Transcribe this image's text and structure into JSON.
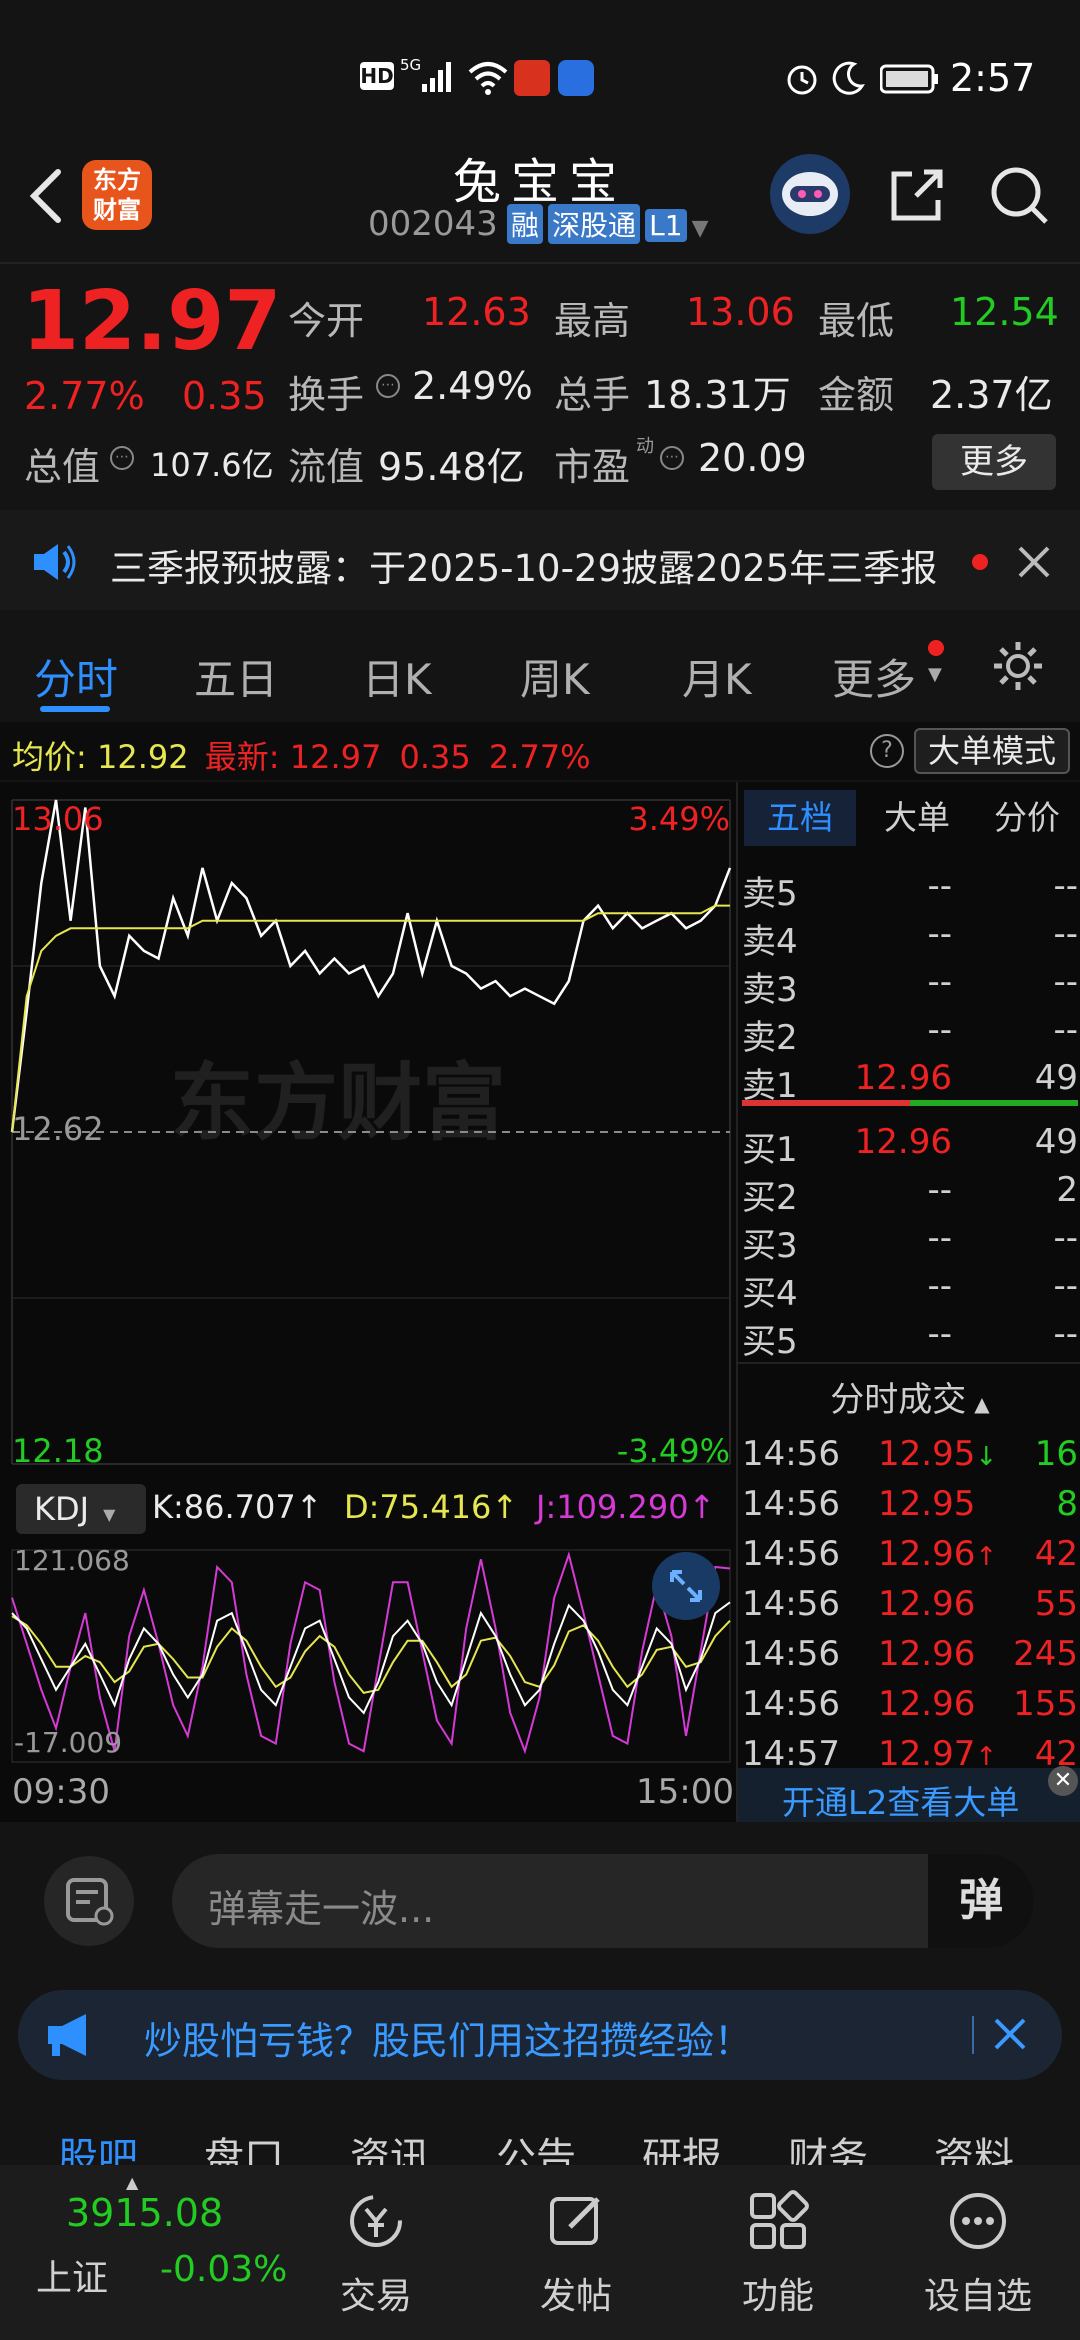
{
  "status_bar": {
    "time": "2:57",
    "left_icons": [
      "hd-icon",
      "5g-signal-icon",
      "wifi-icon",
      "red-app-icon",
      "blue-app-icon"
    ]
  },
  "header": {
    "logo_text_line1": "东方",
    "logo_text_line2": "财富",
    "stock_name": "兔宝宝",
    "stock_code": "002043",
    "badge_rong": "融",
    "badge_sgt": "深股通",
    "badge_level": "L1"
  },
  "quote": {
    "price": "12.97",
    "change_pct": "2.77%",
    "change": "0.35",
    "open_label": "今开",
    "open": "12.63",
    "high_label": "最高",
    "high": "13.06",
    "low_label": "最低",
    "low": "12.54",
    "turnover_label": "换手",
    "turnover": "2.49%",
    "volume_label": "总手",
    "volume": "18.31万",
    "amount_label": "金额",
    "amount": "2.37亿",
    "mktcap_label": "总值",
    "mktcap": "107.6亿",
    "float_label": "流值",
    "float": "95.48亿",
    "pe_label": "市盈",
    "pe_sup": "动",
    "pe": "20.09",
    "more_button": "更多"
  },
  "notice": {
    "text": "三季报预披露：于2025-10-29披露2025年三季报"
  },
  "tabs": [
    {
      "label": "分时"
    },
    {
      "label": "五日"
    },
    {
      "label": "日K"
    },
    {
      "label": "周K"
    },
    {
      "label": "月K"
    },
    {
      "label": "更多"
    }
  ],
  "infobar": {
    "avg_label": "均价:",
    "avg": "12.92",
    "latest_label": "最新:",
    "latest": "12.97",
    "chg": "0.35",
    "chg_pct": "2.77%",
    "mode_button": "大单模式"
  },
  "chart_data": {
    "type": "line",
    "title": "",
    "y_top": "13.06",
    "y_mid": "12.62",
    "y_bot": "12.18",
    "pct_top": "3.49%",
    "pct_bot": "-3.49%",
    "watermark": "东方财富",
    "x_start": "09:30",
    "x_end": "15:00",
    "ylim": [
      12.18,
      13.06
    ],
    "series": [
      {
        "name": "",
        "color": "#ffffff",
        "values": [
          12.62,
          12.78,
          12.95,
          13.06,
          12.9,
          13.05,
          12.84,
          12.8,
          12.88,
          12.86,
          12.85,
          12.93,
          12.88,
          12.97,
          12.9,
          12.95,
          12.93,
          12.88,
          12.9,
          12.84,
          12.86,
          12.83,
          12.85,
          12.83,
          12.84,
          12.8,
          12.83,
          12.91,
          12.83,
          12.9,
          12.84,
          12.83,
          12.81,
          12.82,
          12.8,
          12.81,
          12.8,
          12.79,
          12.82,
          12.9,
          12.92,
          12.89,
          12.91,
          12.89,
          12.9,
          12.91,
          12.89,
          12.9,
          12.92,
          12.97
        ]
      },
      {
        "name": "",
        "color": "#e6e650",
        "values": [
          12.62,
          12.8,
          12.86,
          12.88,
          12.89,
          12.89,
          12.89,
          12.89,
          12.89,
          12.89,
          12.89,
          12.89,
          12.89,
          12.9,
          12.9,
          12.9,
          12.9,
          12.9,
          12.9,
          12.9,
          12.9,
          12.9,
          12.9,
          12.9,
          12.9,
          12.9,
          12.9,
          12.9,
          12.9,
          12.9,
          12.9,
          12.9,
          12.9,
          12.9,
          12.9,
          12.9,
          12.9,
          12.9,
          12.9,
          12.9,
          12.91,
          12.91,
          12.91,
          12.91,
          12.91,
          12.91,
          12.91,
          12.91,
          12.92,
          12.92
        ]
      }
    ]
  },
  "kdj": {
    "selector": "KDJ",
    "k": "K:86.707",
    "d": "D:75.416",
    "j": "J:109.290",
    "y_top": "121.068",
    "y_bot": "-17.009",
    "ylim": [
      -17.009,
      121.068
    ],
    "k_values": [
      80,
      70,
      50,
      30,
      45,
      60,
      40,
      20,
      50,
      70,
      60,
      40,
      25,
      40,
      75,
      80,
      55,
      30,
      20,
      45,
      70,
      75,
      50,
      25,
      15,
      35,
      65,
      75,
      60,
      35,
      20,
      50,
      80,
      65,
      40,
      20,
      30,
      60,
      85,
      75,
      55,
      30,
      20,
      45,
      70,
      60,
      30,
      50,
      80,
      87
    ],
    "d_values": [
      78,
      72,
      60,
      45,
      45,
      52,
      48,
      35,
      42,
      58,
      60,
      50,
      38,
      38,
      58,
      70,
      62,
      45,
      32,
      38,
      55,
      65,
      58,
      40,
      28,
      30,
      48,
      62,
      62,
      48,
      32,
      40,
      62,
      64,
      52,
      35,
      32,
      46,
      68,
      72,
      62,
      45,
      32,
      40,
      56,
      58,
      45,
      48,
      65,
      75
    ],
    "j_values": [
      90,
      60,
      30,
      5,
      45,
      80,
      25,
      -10,
      65,
      95,
      60,
      20,
      0,
      45,
      110,
      100,
      40,
      0,
      -5,
      60,
      100,
      95,
      35,
      -5,
      -10,
      45,
      100,
      100,
      55,
      10,
      -5,
      70,
      115,
      70,
      15,
      -10,
      25,
      90,
      118,
      80,
      40,
      0,
      -5,
      55,
      98,
      65,
      0,
      55,
      110,
      109
    ]
  },
  "side_tabs": [
    {
      "label": "五档"
    },
    {
      "label": "大单"
    },
    {
      "label": "分价"
    }
  ],
  "order_book": {
    "asks": [
      {
        "label": "卖5",
        "price": "--",
        "vol": "--"
      },
      {
        "label": "卖4",
        "price": "--",
        "vol": "--"
      },
      {
        "label": "卖3",
        "price": "--",
        "vol": "--"
      },
      {
        "label": "卖2",
        "price": "--",
        "vol": "--"
      },
      {
        "label": "卖1",
        "price": "12.96",
        "vol": "49"
      }
    ],
    "bids": [
      {
        "label": "买1",
        "price": "12.96",
        "vol": "49"
      },
      {
        "label": "买2",
        "price": "--",
        "vol": "2"
      },
      {
        "label": "买3",
        "price": "--",
        "vol": "--"
      },
      {
        "label": "买4",
        "price": "--",
        "vol": "--"
      },
      {
        "label": "买5",
        "price": "--",
        "vol": "--"
      }
    ]
  },
  "trades": {
    "header": "分时成交",
    "rows": [
      {
        "time": "14:56",
        "price": "12.95",
        "arrow": "↓",
        "vol": "16",
        "vol_color": "#22cc22"
      },
      {
        "time": "14:56",
        "price": "12.95",
        "arrow": "",
        "vol": "8",
        "vol_color": "#22cc22"
      },
      {
        "time": "14:56",
        "price": "12.96",
        "arrow": "↑",
        "vol": "42",
        "vol_color": "#ee2222"
      },
      {
        "time": "14:56",
        "price": "12.96",
        "arrow": "",
        "vol": "55",
        "vol_color": "#ee2222"
      },
      {
        "time": "14:56",
        "price": "12.96",
        "arrow": "",
        "vol": "245",
        "vol_color": "#ee2222"
      },
      {
        "time": "14:56",
        "price": "12.96",
        "arrow": "",
        "vol": "155",
        "vol_color": "#ee2222"
      },
      {
        "time": "14:57",
        "price": "12.97",
        "arrow": "↑",
        "vol": "42",
        "vol_color": "#ee2222"
      }
    ],
    "l2_link": "开通L2查看大单"
  },
  "comment": {
    "placeholder": "弹幕走一波...",
    "danmu_button": "弹"
  },
  "promo": {
    "text": "炒股怕亏钱？股民们用这招攒经验！"
  },
  "subtabs": [
    {
      "label": "股吧"
    },
    {
      "label": "盘口"
    },
    {
      "label": "资讯"
    },
    {
      "label": "公告"
    },
    {
      "label": "研报"
    },
    {
      "label": "财务"
    },
    {
      "label": "资料"
    }
  ],
  "bottom_nav": {
    "index_value": "3915.08",
    "index_name": "上证",
    "index_change": "-0.03%",
    "items": [
      {
        "label": "交易"
      },
      {
        "label": "发帖"
      },
      {
        "label": "功能"
      },
      {
        "label": "设自选"
      }
    ]
  },
  "colors": {
    "up": "#ee2222",
    "down": "#22cc22",
    "accent": "#2e8fff",
    "avg_line": "#e6e650",
    "j_line": "#d63ad6"
  }
}
